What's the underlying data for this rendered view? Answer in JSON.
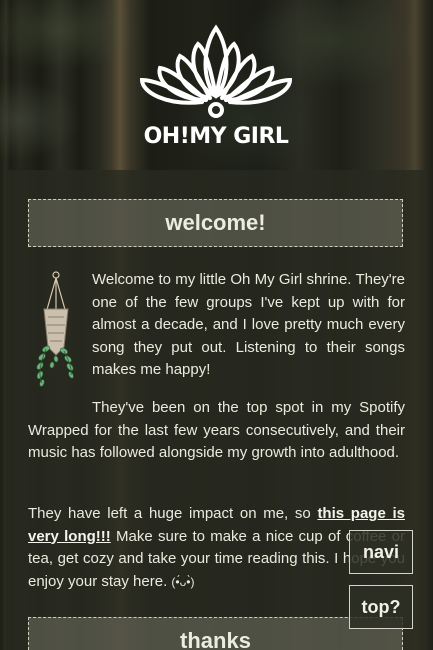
{
  "logo": {
    "text": "OH!MY GIRL"
  },
  "welcome": {
    "heading": "welcome!",
    "paragraph1": "Welcome to my little Oh My Girl shrine. They're one of the few groups I've kept up with for almost a decade, and I love pretty much every song they put out. Listening to their songs makes me happy!",
    "paragraph2": "They've been on the top spot in my Spotify Wrapped for the last few years consecutively, and their music has followed alongside my growth into adulthood.",
    "paragraph3_before": "They have left a huge impact on me, so ",
    "paragraph3_link": "this page is very long!!!",
    "paragraph3_after": " Make sure to make a nice cup of coffee or tea, get cozy and take your time reading this. I hope you enjoy your stay here. ",
    "kaomoji": "(•́ᴗ•̀)"
  },
  "thanks": {
    "heading": "thanks"
  },
  "buttons": {
    "navi": "navi",
    "top": "top?"
  },
  "colors": {
    "panel": "#2a2c20",
    "heading_bg": "#6b6b5e",
    "text": "#ebebdd",
    "leaf_green": "#6bb37a"
  },
  "icons": {
    "plant": "hanging-plant-icon",
    "crown": "crown-logo-icon"
  }
}
